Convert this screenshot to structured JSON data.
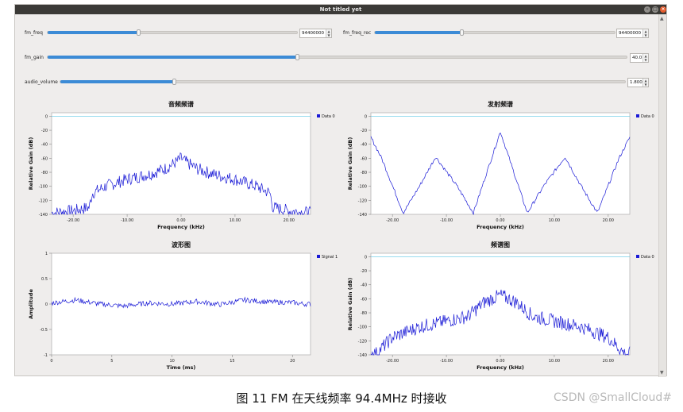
{
  "window": {
    "title": "Not titled yet"
  },
  "controls": {
    "fm_freq": {
      "label": "fm_freq",
      "value": "94400000",
      "level": 0.36
    },
    "fm_freq_rec": {
      "label": "fm_freq_rec",
      "value": "94400000",
      "level": 0.36
    },
    "fm_gain": {
      "label": "fm_gain",
      "value": "40.0",
      "level": 0.43
    },
    "audio_volume": {
      "label": "audio_volume",
      "value": "1.800",
      "level": 0.2
    }
  },
  "plots": {
    "audio_spectrum": {
      "title": "音频频谱",
      "xlabel": "Frequency (kHz)",
      "ylabel": "Relative Gain (dB)",
      "legend": "Data 0",
      "yticks": [
        "0",
        "-20",
        "-40",
        "-60",
        "-80",
        "-100",
        "-120",
        "-140"
      ],
      "xticks": [
        "-20.00",
        "-10.00",
        "0.00",
        "10.00",
        "20.00"
      ]
    },
    "tx_spectrum": {
      "title": "发射频谱",
      "xlabel": "Frequency (kHz)",
      "ylabel": "Relative Gain (dB)",
      "legend": "Data 0",
      "yticks": [
        "0",
        "-20",
        "-40",
        "-60",
        "-80",
        "-100",
        "-120",
        "-140"
      ],
      "xticks": [
        "-20.00",
        "-10.00",
        "0.00",
        "10.00",
        "20.00"
      ]
    },
    "waveform": {
      "title": "波形图",
      "xlabel": "Time (ms)",
      "ylabel": "Amplitude",
      "legend": "Signal 1",
      "yticks": [
        "1",
        "0.5",
        "0",
        "-0.5",
        "-1"
      ],
      "xticks": [
        "0",
        "5",
        "10",
        "15",
        "20"
      ]
    },
    "spectrum": {
      "title": "频谱图",
      "xlabel": "Frequency (kHz)",
      "ylabel": "Relative Gain (dB)",
      "legend": "Data 0",
      "yticks": [
        "0",
        "-20",
        "-40",
        "-60",
        "-80",
        "-100",
        "-120",
        "-140"
      ],
      "xticks": [
        "-20.00",
        "-10.00",
        "0.00",
        "10.00",
        "20.00"
      ]
    }
  },
  "chart_data": [
    {
      "type": "line",
      "title": "音频频谱",
      "xlabel": "Frequency (kHz)",
      "ylabel": "Relative Gain (dB)",
      "xlim": [
        -24,
        24
      ],
      "ylim": [
        -140,
        5
      ],
      "series": [
        {
          "name": "Data 0",
          "x": [
            -24,
            -20,
            -17,
            -16.5,
            -14,
            -10,
            -6,
            -3,
            -1,
            0,
            1,
            3,
            6,
            10,
            14,
            16.5,
            17,
            20,
            24
          ],
          "y": [
            -138,
            -135,
            -130,
            -110,
            -100,
            -90,
            -83,
            -75,
            -66,
            -60,
            -66,
            -75,
            -83,
            -90,
            -100,
            -110,
            -130,
            -135,
            -138
          ]
        }
      ]
    },
    {
      "type": "line",
      "title": "发射频谱",
      "xlabel": "Frequency (kHz)",
      "ylabel": "Relative Gain (dB)",
      "xlim": [
        -24,
        24
      ],
      "ylim": [
        -140,
        5
      ],
      "series": [
        {
          "name": "Data 0",
          "x": [
            -24,
            -22,
            -18,
            -15,
            -12,
            -8,
            -5,
            0,
            5,
            8,
            12,
            15,
            18,
            22,
            24
          ],
          "y": [
            -30,
            -60,
            -138,
            -100,
            -58,
            -100,
            -138,
            -22,
            -138,
            -100,
            -58,
            -100,
            -138,
            -60,
            -30
          ]
        }
      ]
    },
    {
      "type": "line",
      "title": "波形图",
      "xlabel": "Time (ms)",
      "ylabel": "Amplitude",
      "xlim": [
        0,
        21.5
      ],
      "ylim": [
        -1,
        1
      ],
      "series": [
        {
          "name": "Signal 1",
          "x": [
            0,
            2,
            4,
            6,
            8,
            10,
            12,
            14,
            16,
            18,
            20,
            21
          ],
          "y": [
            0.02,
            0.08,
            0.0,
            -0.04,
            0.02,
            0.0,
            0.05,
            -0.01,
            0.08,
            0.04,
            0.03,
            0.0
          ]
        }
      ]
    },
    {
      "type": "line",
      "title": "频谱图",
      "xlabel": "Frequency (kHz)",
      "ylabel": "Relative Gain (dB)",
      "xlim": [
        -24,
        24
      ],
      "ylim": [
        -140,
        5
      ],
      "series": [
        {
          "name": "Data 0",
          "x": [
            -23,
            -20,
            -15,
            -10,
            -6,
            -3,
            0,
            3,
            6,
            10,
            15,
            20,
            23
          ],
          "y": [
            -138,
            -115,
            -100,
            -92,
            -85,
            -65,
            -55,
            -65,
            -85,
            -92,
            -100,
            -115,
            -138
          ]
        }
      ]
    }
  ],
  "caption": "图 11 FM 在天线频率 94.4MHz 时接收",
  "watermark": "CSDN @SmallCloud#"
}
